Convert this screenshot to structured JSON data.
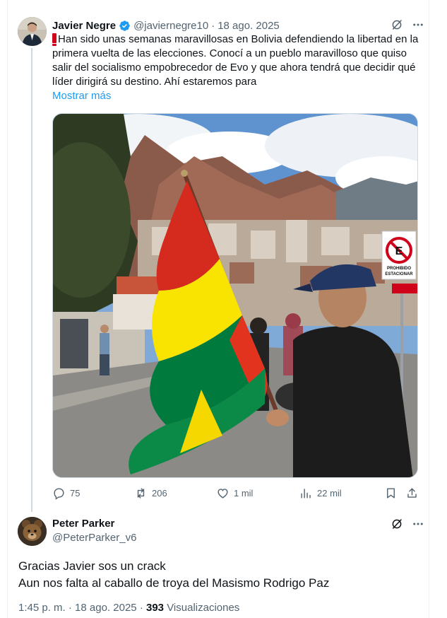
{
  "tweet": {
    "author_name": "Javier Negre",
    "handle": "@javiernegre10",
    "date": "18 ago. 2025",
    "text": "Han sido unas semanas maravillosas en Bolivia defendiendo la libertad en la primera vuelta de las elecciones. Conocí a un pueblo maravilloso que quiso salir del socialismo empobrecedor de Evo y que ahora tendrá que decidir qué líder dirigirá su destino. Ahí estaremos para",
    "show_more": "Mostrar más",
    "image": {
      "sign_text_line1": "PROHIBIDO",
      "sign_text_line2": "ESTACIONAR",
      "sign_letter": "E"
    },
    "stats": {
      "replies": "75",
      "reposts": "206",
      "likes": "1 mil",
      "views": "22 mil"
    }
  },
  "reply": {
    "author_name": "Peter Parker",
    "handle": "@PeterParker_v6",
    "text_line1": "Gracias Javier sos un crack",
    "text_line2": "Aun nos falta al caballo de troya del Masismo Rodrigo Paz",
    "time": "1:45 p. m.",
    "date": "18 ago. 2025",
    "views_count": "393",
    "views_label": "Visualizaciones"
  },
  "colors": {
    "accent": "#1d9bf0",
    "muted": "#536471",
    "text": "#0f1419",
    "flag_red": "#d52b1e",
    "flag_yellow": "#f9e300",
    "flag_green": "#007a3d"
  },
  "icons": [
    "verified-badge-icon",
    "grok-icon",
    "more-icon",
    "reply-icon",
    "repost-icon",
    "like-icon",
    "views-icon",
    "bookmark-icon",
    "share-icon"
  ]
}
